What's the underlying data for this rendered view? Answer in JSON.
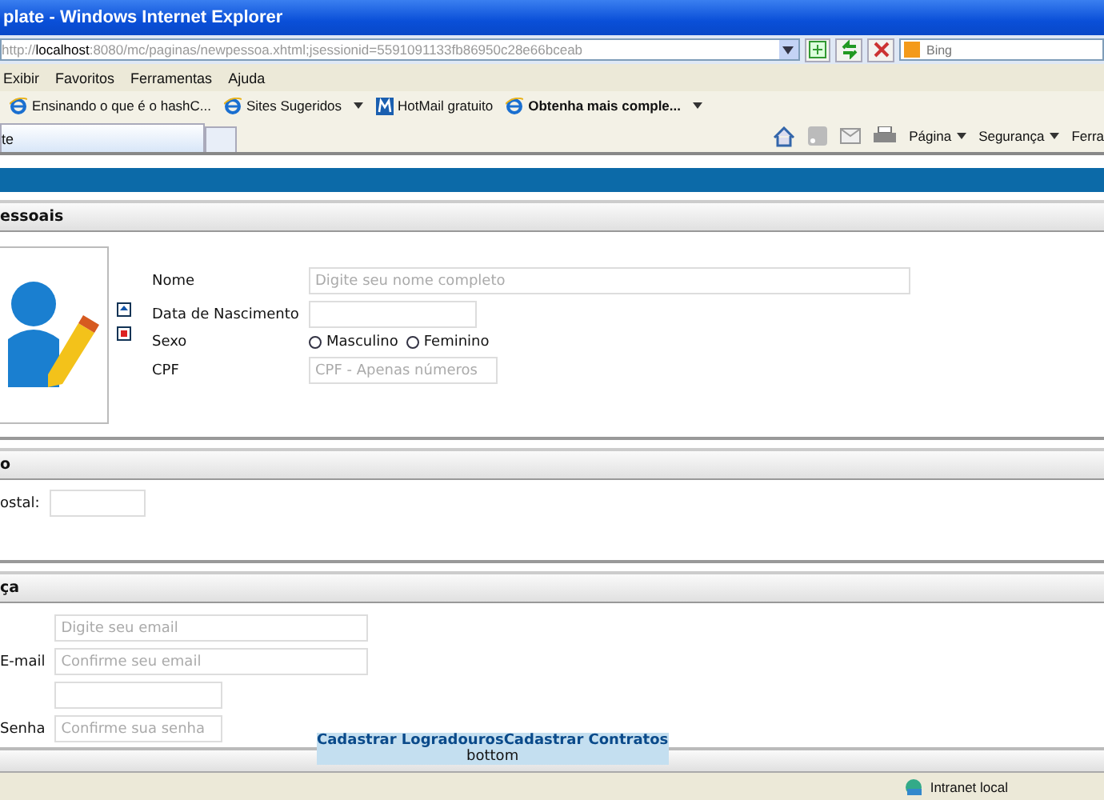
{
  "window": {
    "title": "plate - Windows Internet Explorer"
  },
  "address_bar": {
    "url_prefix": "http://",
    "host": "localhost",
    "url_rest": ":8080/mc/paginas/newpessoa.xhtml;jsessionid=5591091133fb86950c28e66bceab",
    "search_placeholder": "Bing"
  },
  "menu": [
    "Exibir",
    "Favoritos",
    "Ferramentas",
    "Ajuda"
  ],
  "favorites": [
    {
      "label": "Ensinando o que é o hashC...",
      "kind": "ie",
      "bold": false,
      "dropdown": false
    },
    {
      "label": "Sites Sugeridos",
      "kind": "ie",
      "bold": false,
      "dropdown": true
    },
    {
      "label": "HotMail gratuito",
      "kind": "msn",
      "bold": false,
      "dropdown": false
    },
    {
      "label": "Obtenha mais comple...",
      "kind": "ie",
      "bold": true,
      "dropdown": true
    }
  ],
  "tab": {
    "label": "te"
  },
  "command_bar": [
    "Página",
    "Segurança",
    "Ferra"
  ],
  "sections": [
    {
      "title": "essoais",
      "kind": "person",
      "fields": [
        {
          "label": "Nome",
          "kind": "text",
          "placeholder": "Digite seu nome completo"
        },
        {
          "label": "Data de Nascimento",
          "kind": "text"
        },
        {
          "label": "Sexo",
          "kind": "radio",
          "options": [
            {
              "label": "Masculino",
              "selected": false
            },
            {
              "label": "Feminino",
              "selected": false
            }
          ]
        },
        {
          "label": "CPF",
          "kind": "text",
          "placeholder": "CPF - Apenas números"
        }
      ]
    },
    {
      "title": "o",
      "kind": "address",
      "fields": [
        {
          "label": "ostal:",
          "kind": "text"
        }
      ]
    },
    {
      "title": "ça",
      "kind": "security",
      "fields": [
        {
          "kind": "text",
          "placeholder": "Digite seu email"
        },
        {
          "label": "E-mail",
          "kind": "text",
          "placeholder": "Confirme seu email"
        },
        {
          "kind": "text"
        },
        {
          "label": "Senha",
          "kind": "text",
          "placeholder": "Confirme sua senha"
        }
      ]
    }
  ],
  "links": [
    "Cadastrar Logradouros",
    "Cadastrar Contratos"
  ],
  "footer": "bottom",
  "status_bar": {
    "zone": "Intranet local"
  }
}
